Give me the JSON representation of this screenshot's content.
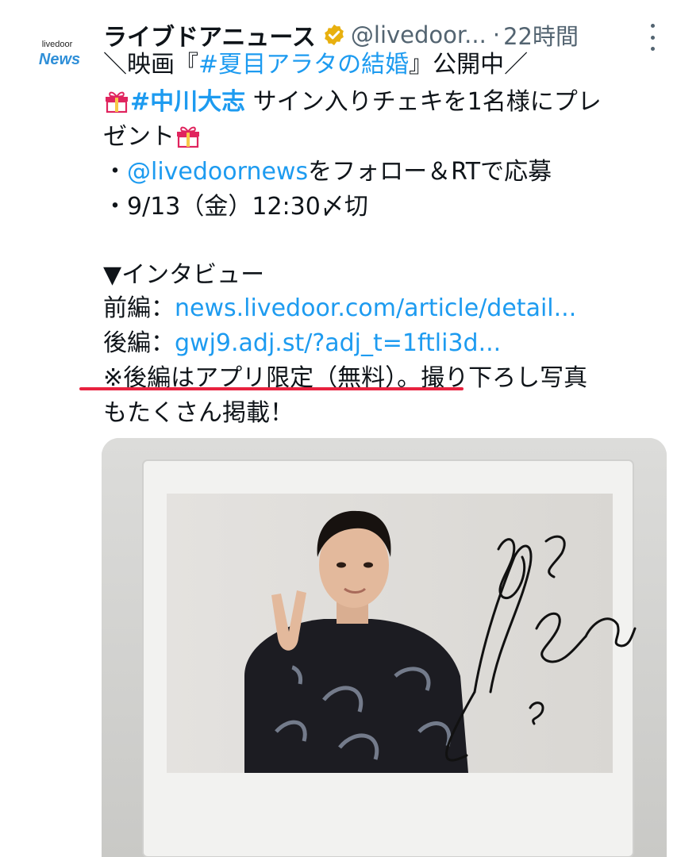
{
  "account": {
    "avatar_line1": "livedoor",
    "avatar_line2": "News",
    "name": "ライブドアニュース",
    "handle": "@livedoor...",
    "separator": "·",
    "time": "22時間",
    "verified_color": "#e8b00f"
  },
  "tweet": {
    "line1_prefix": "＼映画『",
    "line1_hashtag": "#夏目アラタの結婚",
    "line1_suffix": "』公開中／",
    "line2_hashtag": "#中川大志",
    "line2_text": " サイン入りチェキを1名様にプレ",
    "line3_text": "ゼント",
    "bullet1_prefix": "・",
    "bullet1_mention": "@livedoornews",
    "bullet1_text": "をフォロー＆RTで応募",
    "bullet2": "・9/13（金）12:30〆切",
    "section_header": "▼インタビュー",
    "part1_label": "前編：",
    "part1_link": "news.livedoor.com/article/detail...",
    "part2_label": "後編：",
    "part2_link": "gwj9.adj.st/?adj_t=1ftli3d...",
    "note_line1": "※後編はアプリ限定（無料）。撮り下ろし写真",
    "note_line2": "もたくさん掲載！"
  },
  "colors": {
    "link": "#1d9bf0",
    "underline": "#e8223f",
    "text": "#0f1419",
    "secondary": "#536471"
  },
  "media": {
    "icon": "signed-instax-photo"
  }
}
